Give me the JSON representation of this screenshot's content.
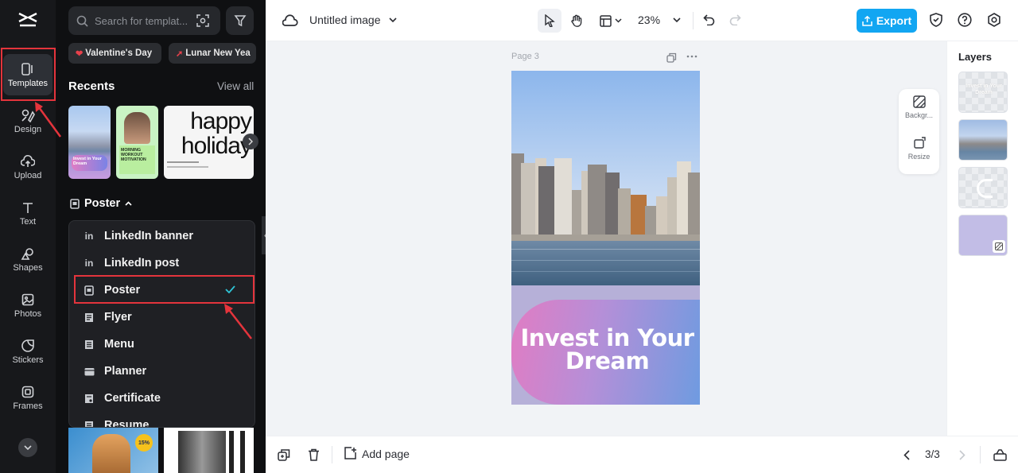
{
  "rail": {
    "items": [
      {
        "label": "Templates"
      },
      {
        "label": "Design"
      },
      {
        "label": "Upload"
      },
      {
        "label": "Text"
      },
      {
        "label": "Shapes"
      },
      {
        "label": "Photos"
      },
      {
        "label": "Stickers"
      },
      {
        "label": "Frames"
      }
    ]
  },
  "panel": {
    "search_placeholder": "Search for templat...",
    "chips": [
      "Valentine's Day",
      "Lunar New Yea"
    ],
    "recents_title": "Recents",
    "view_all": "View all",
    "recents": [
      {
        "text": "Invest in Your Dream"
      },
      {
        "text": "MORNING WORKOUT MOTIVATION"
      },
      {
        "text": "happy holiday"
      }
    ],
    "category_label": "Poster",
    "dropdown": [
      {
        "label": "LinkedIn banner",
        "icon": "linkedin-icon",
        "selected": false
      },
      {
        "label": "LinkedIn post",
        "icon": "linkedin-icon",
        "selected": false
      },
      {
        "label": "Poster",
        "icon": "poster-icon",
        "selected": true
      },
      {
        "label": "Flyer",
        "icon": "flyer-icon",
        "selected": false
      },
      {
        "label": "Menu",
        "icon": "menu-doc-icon",
        "selected": false
      },
      {
        "label": "Planner",
        "icon": "planner-icon",
        "selected": false
      },
      {
        "label": "Certificate",
        "icon": "certificate-icon",
        "selected": false
      },
      {
        "label": "Resume",
        "icon": "resume-icon",
        "selected": false
      }
    ],
    "badge": "15%"
  },
  "topbar": {
    "doc_title": "Untitled image",
    "zoom": "23%",
    "export_label": "Export"
  },
  "canvas": {
    "page_label": "Page 3",
    "poster_headline": "Invest in Your Dream",
    "tools": [
      {
        "label": "Backgr..."
      },
      {
        "label": "Resize"
      }
    ]
  },
  "layers": {
    "title": "Layers",
    "thumb_text": "Invest in Your Dream"
  },
  "bottombar": {
    "add_page": "Add page",
    "page_counter": "3/3"
  },
  "colors": {
    "accent": "#12a6f2",
    "highlight": "#e4343c",
    "check": "#2ec4d6"
  }
}
